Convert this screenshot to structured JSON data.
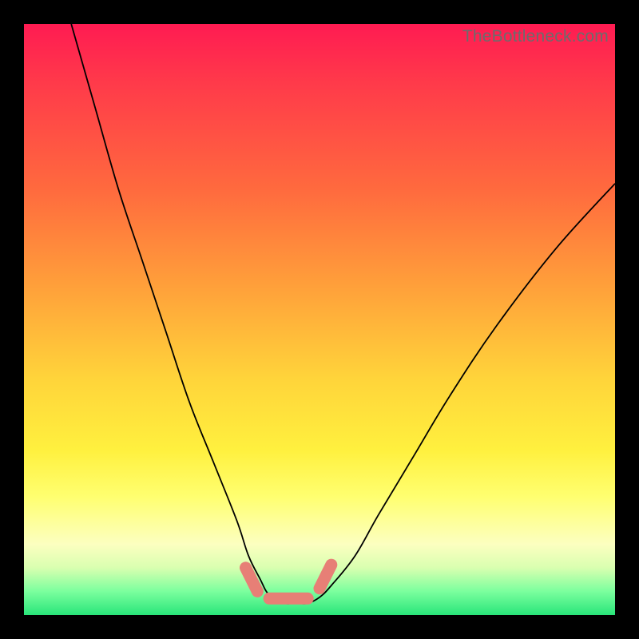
{
  "watermark": "TheBottleneck.com",
  "colors": {
    "background_frame": "#000000",
    "gradient_top": "#ff1b52",
    "gradient_bottom": "#29e57a",
    "curve": "#000000",
    "marker": "#e77f76"
  },
  "chart_data": {
    "type": "line",
    "title": "",
    "xlabel": "",
    "ylabel": "",
    "xlim": [
      0,
      100
    ],
    "ylim": [
      0,
      100
    ],
    "grid": false,
    "legend": false,
    "series": [
      {
        "name": "bottleneck-curve",
        "x": [
          8,
          12,
          16,
          20,
          24,
          28,
          32,
          36,
          38,
          40,
          41,
          42,
          44,
          46,
          48,
          50,
          52,
          56,
          60,
          66,
          72,
          80,
          90,
          100
        ],
        "y": [
          100,
          86,
          72,
          60,
          48,
          36,
          26,
          16,
          10,
          6,
          4,
          3,
          2,
          2,
          2,
          3,
          5,
          10,
          17,
          27,
          37,
          49,
          62,
          73
        ]
      }
    ],
    "annotations": [
      {
        "name": "trough-marker",
        "shape": "segmented-line",
        "points_x": [
          37.5,
          39.5,
          41.5,
          48.0,
          50.0,
          52.0
        ],
        "points_y": [
          8.0,
          4.0,
          2.8,
          2.8,
          4.5,
          8.5
        ]
      }
    ]
  }
}
